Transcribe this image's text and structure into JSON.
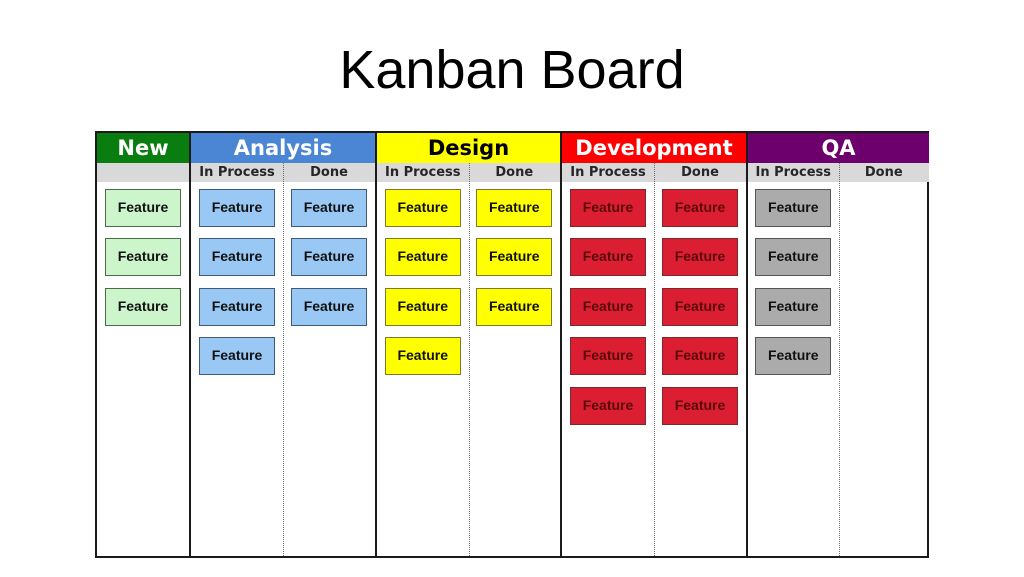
{
  "title": "Kanban Board",
  "stages": [
    {
      "name": "New",
      "header_color": "#0a7d10",
      "header_text_color": "#ffffff",
      "card_color": "#ccf5cc",
      "card_border": "#4a6a4a",
      "card_text_color": "#111111",
      "subcolumns": [
        {
          "label": "",
          "cards": [
            "Feature",
            "Feature",
            "Feature"
          ]
        }
      ]
    },
    {
      "name": "Analysis",
      "header_color": "#4a86d4",
      "header_text_color": "#ffffff",
      "card_color": "#99c8f5",
      "card_border": "#3d5a7a",
      "card_text_color": "#111111",
      "subcolumns": [
        {
          "label": "In Process",
          "cards": [
            "Feature",
            "Feature",
            "Feature",
            "Feature"
          ]
        },
        {
          "label": "Done",
          "cards": [
            "Feature",
            "Feature",
            "Feature"
          ]
        }
      ]
    },
    {
      "name": "Design",
      "header_color": "#ffff00",
      "header_text_color": "#000000",
      "card_color": "#ffff00",
      "card_border": "#7a7a2a",
      "card_text_color": "#111111",
      "subcolumns": [
        {
          "label": "In Process",
          "cards": [
            "Feature",
            "Feature",
            "Feature",
            "Feature"
          ]
        },
        {
          "label": "Done",
          "cards": [
            "Feature",
            "Feature",
            "Feature"
          ]
        }
      ]
    },
    {
      "name": "Development",
      "header_color": "#ff0000",
      "header_text_color": "#ffffff",
      "card_color": "#dc1e32",
      "card_border": "#7a2a2a",
      "card_text_color": "#5a0a0a",
      "subcolumns": [
        {
          "label": "In Process",
          "cards": [
            "Feature",
            "Feature",
            "Feature",
            "Feature",
            "Feature"
          ]
        },
        {
          "label": "Done",
          "cards": [
            "Feature",
            "Feature",
            "Feature",
            "Feature",
            "Feature"
          ]
        }
      ]
    },
    {
      "name": "QA",
      "header_color": "#6e006e",
      "header_text_color": "#ffffff",
      "card_color": "#ababab",
      "card_border": "#555555",
      "card_text_color": "#111111",
      "subcolumns": [
        {
          "label": "In Process",
          "cards": [
            "Feature",
            "Feature",
            "Feature",
            "Feature"
          ]
        },
        {
          "label": "Done",
          "cards": []
        }
      ]
    }
  ]
}
